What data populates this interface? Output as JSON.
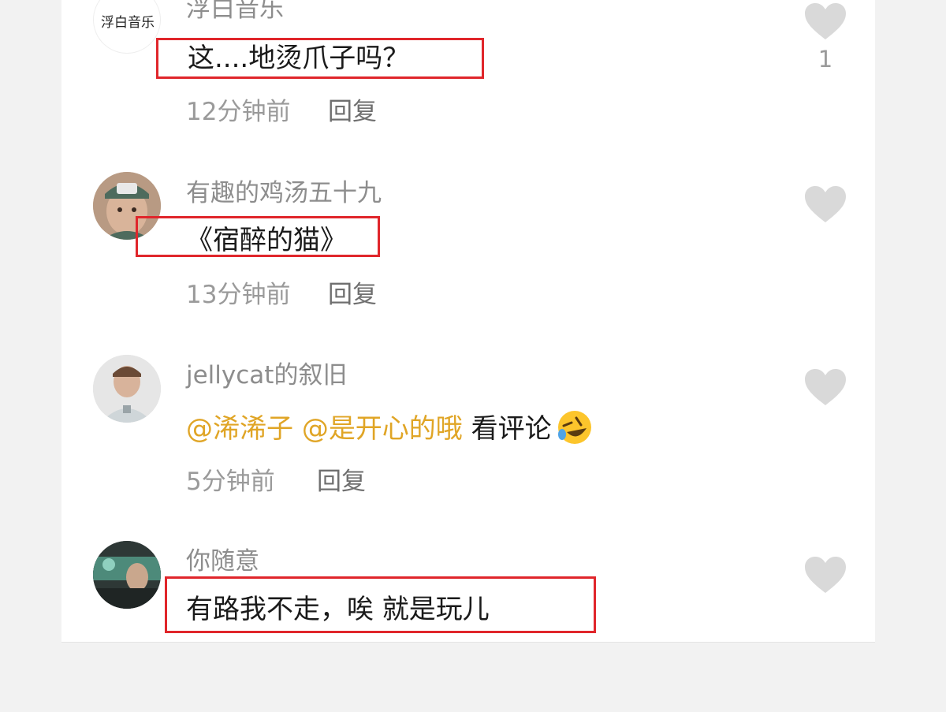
{
  "colors": {
    "username": "#8d8d8d",
    "content": "#1a1a1a",
    "mention": "#e0a526",
    "timestamp": "#9a9a9a",
    "reply": "#6f6f6f",
    "like_icon": "#d9d9d9",
    "highlight_box": "#e0262b",
    "page_background": "#f2f2f2",
    "panel_background": "#ffffff"
  },
  "comments": [
    {
      "avatar_icon": "logo-avatar",
      "avatar_text": "浮白音乐",
      "username": "浮白音乐",
      "content": "这....地烫爪子吗？",
      "timestamp": "12分钟前",
      "reply_label": "回复",
      "like_icon": "heart-icon",
      "like_count": "1",
      "highlighted": true
    },
    {
      "avatar_icon": "user-avatar",
      "username": "有趣的鸡汤五十九",
      "content": "《宿醉的猫》",
      "timestamp": "13分钟前",
      "reply_label": "回复",
      "like_icon": "heart-icon",
      "like_count": "",
      "highlighted": true
    },
    {
      "avatar_icon": "user-avatar",
      "username": "jellycat的叙旧",
      "mentions": [
        "@浠浠子",
        "@是开心的哦"
      ],
      "content": "看评论",
      "content_emoji": "rolling-on-floor-laughing-emoji",
      "timestamp": "5分钟前",
      "reply_label": "回复",
      "like_icon": "heart-icon",
      "like_count": "",
      "highlighted": false
    },
    {
      "avatar_icon": "user-avatar",
      "username": "你随意",
      "content": "有路我不走，唉 就是玩儿",
      "like_icon": "heart-icon",
      "like_count": "",
      "highlighted": true
    }
  ]
}
